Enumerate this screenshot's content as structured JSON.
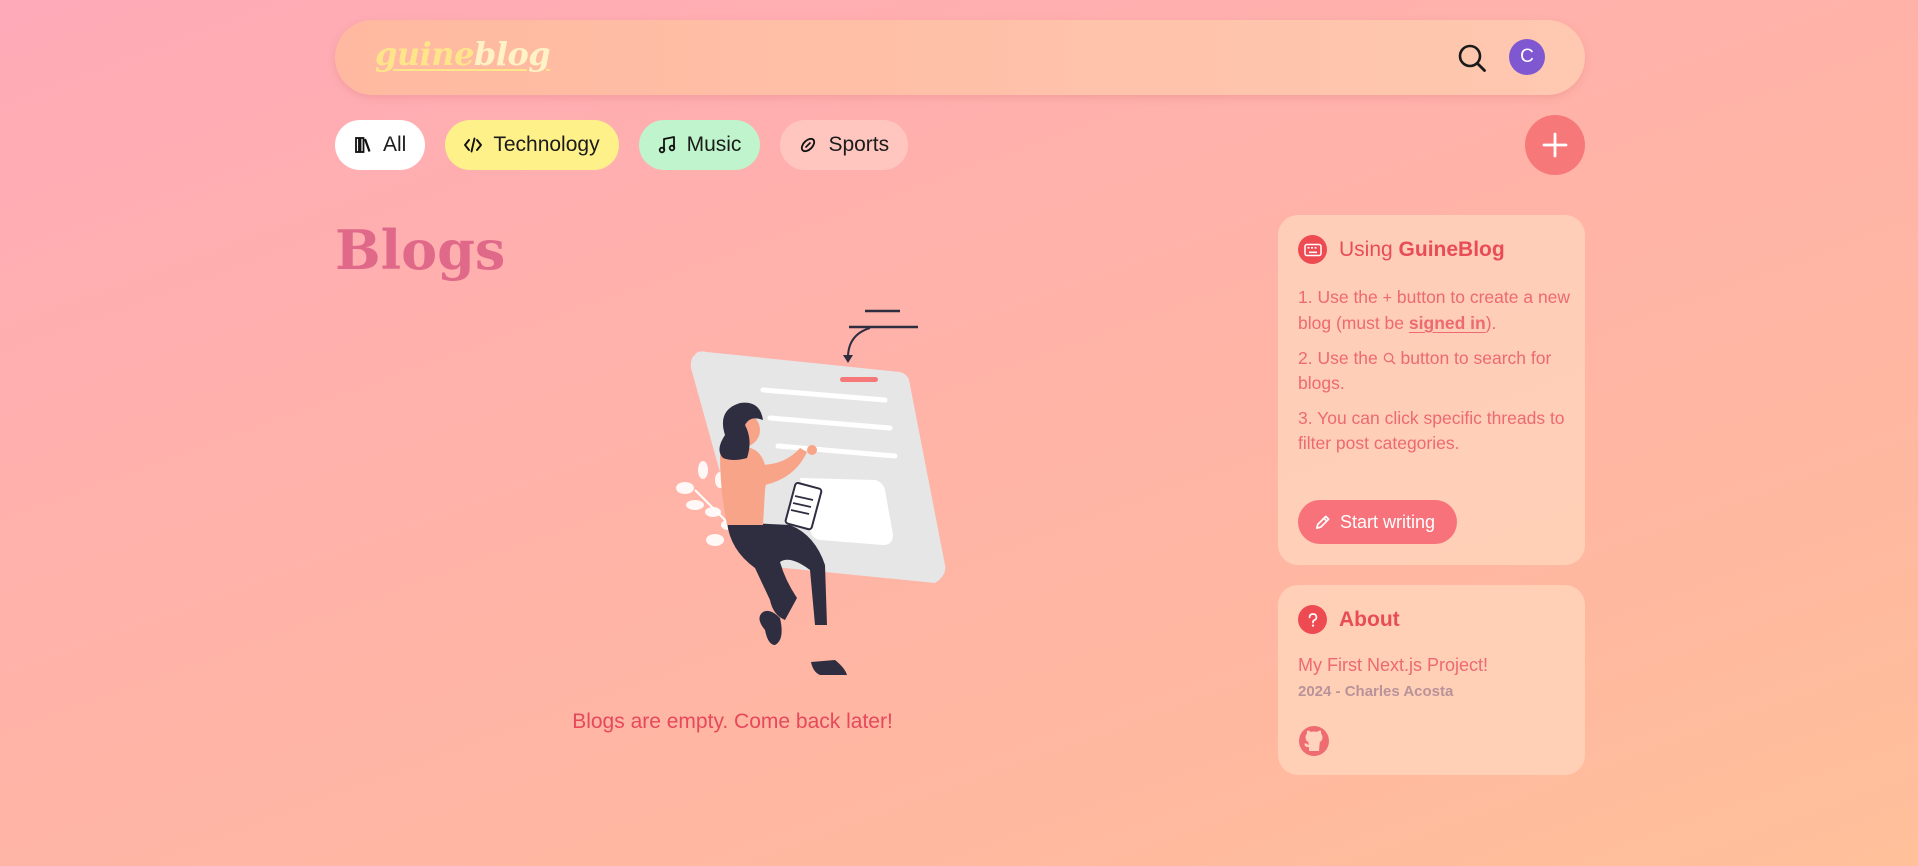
{
  "header": {
    "logo_part1": "guine",
    "logo_part2": "blog",
    "search_icon": "search-icon",
    "avatar_letter": "C"
  },
  "tabs": [
    {
      "label": "All",
      "icon": "books-icon",
      "color": "#ffffff"
    },
    {
      "label": "Technology",
      "icon": "code-icon",
      "color": "#fff18a"
    },
    {
      "label": "Music",
      "icon": "music-note-icon",
      "color": "#bff4cc"
    },
    {
      "label": "Sports",
      "icon": "football-icon",
      "color": "#ffc6c0"
    }
  ],
  "add_button_icon": "plus-icon",
  "main": {
    "title": "Blogs",
    "empty_message": "Blogs are empty. Come back later!"
  },
  "sidebar": {
    "using": {
      "title_prefix": "Using",
      "title_brand": "GuineBlog",
      "icon": "keyboard-icon",
      "step1_a": "1. Use the",
      "step1_b": "button to create a new blog (must be",
      "step1_link": "signed in",
      "step1_c": ").",
      "step2_a": "2. Use the",
      "step2_b": "button to search for blogs.",
      "step3": "3. You can click specific threads to filter post categories.",
      "start_button": "Start writing"
    },
    "about": {
      "title": "About",
      "icon": "question-icon",
      "text": "My First Next.js Project!",
      "credit": "2024 - Charles Acosta",
      "github_icon": "github-icon"
    }
  },
  "colors": {
    "accent": "#f77878",
    "title": "#e0698a",
    "avatar": "#7f57d0"
  }
}
